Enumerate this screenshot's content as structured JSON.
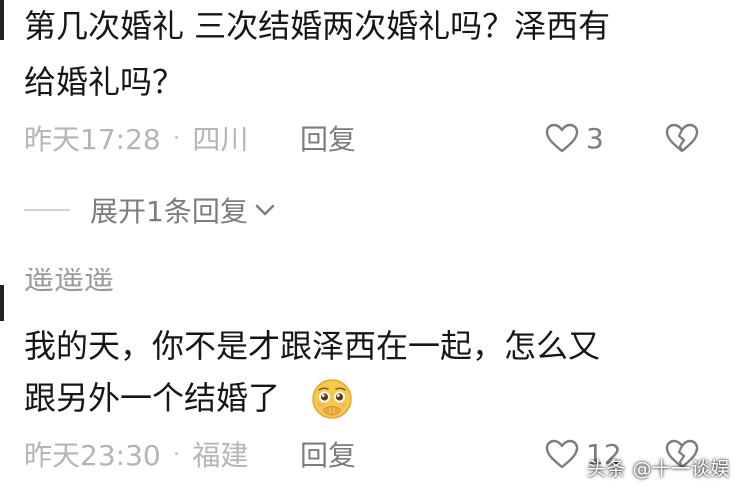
{
  "comment1": {
    "line1": "第几次婚礼 三次结婚两次婚礼吗？泽西有",
    "line2": "给婚礼吗？",
    "time": "昨天17:28",
    "separator": "·",
    "location": "四川",
    "reply_label": "回复",
    "like_count": "3",
    "like_icon": "heart-outline",
    "dislike_icon": "broken-heart"
  },
  "expand": {
    "label": "展开1条回复",
    "icon": "chevron-down"
  },
  "comment2": {
    "username": "遥遥遥",
    "line1": "我的天，你不是才跟泽西在一起，怎么又",
    "line2": "跟另外一个结婚了",
    "emoji": "pleading-face",
    "time": "昨天23:30",
    "separator": "·",
    "location": "福建",
    "reply_label": "回复",
    "like_count": "12",
    "like_icon": "heart-outline",
    "dislike_icon": "broken-heart"
  },
  "watermark": {
    "text": "头条 @十一谈娱"
  },
  "colors": {
    "text": "#161616",
    "meta": "#b5b5b5",
    "action": "#7d7d7d",
    "emoji": "#f7c948"
  }
}
